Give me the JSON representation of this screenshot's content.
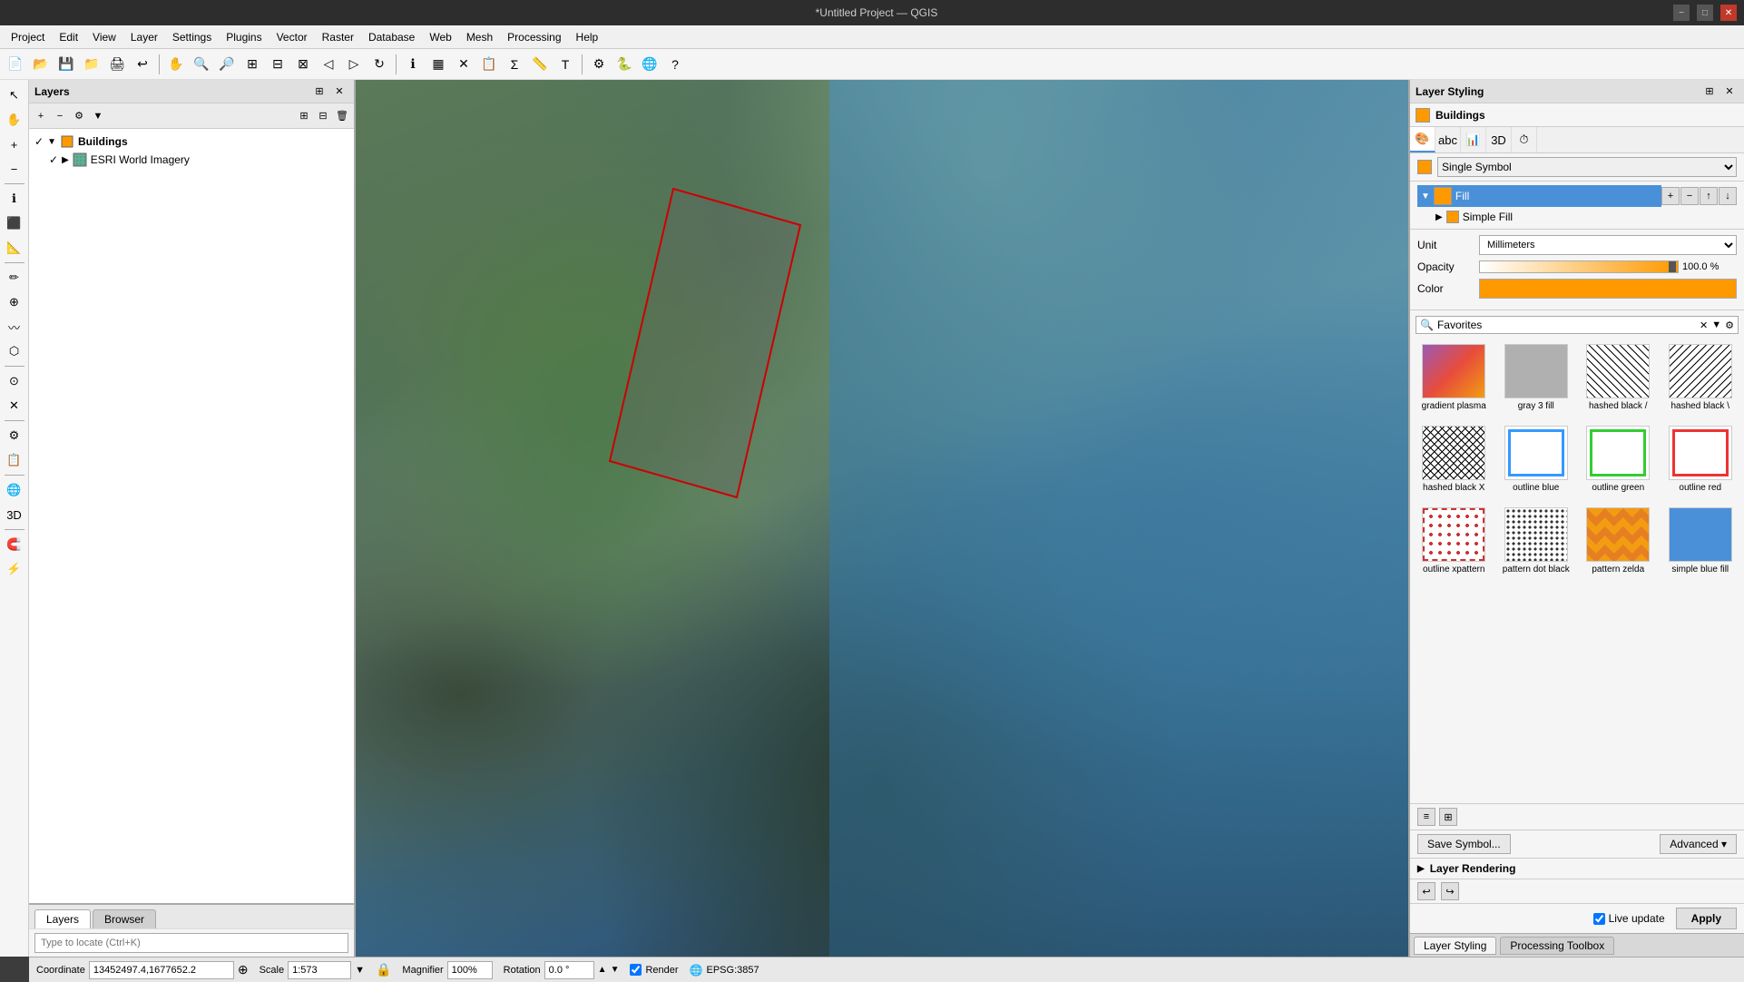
{
  "titlebar": {
    "title": "*Untitled Project — QGIS",
    "minimize": "−",
    "maximize": "□",
    "close": "✕"
  },
  "menubar": {
    "items": [
      "Project",
      "Edit",
      "View",
      "Layer",
      "Settings",
      "Plugins",
      "Vector",
      "Raster",
      "Database",
      "Web",
      "Mesh",
      "Processing",
      "Help"
    ]
  },
  "layers_panel": {
    "title": "Layers",
    "layers": [
      {
        "name": "Buildings",
        "type": "vector",
        "visible": true,
        "bold": true
      },
      {
        "name": "ESRI World Imagery",
        "type": "raster",
        "visible": true,
        "bold": false
      }
    ]
  },
  "layer_styling": {
    "title": "Layer Styling",
    "layer_name": "Buildings",
    "renderer_type": "Single Symbol",
    "symbol_tree": {
      "fill_label": "Fill",
      "simple_fill_label": "Simple Fill"
    },
    "properties": {
      "unit_label": "Unit",
      "unit_value": "Millimeters",
      "opacity_label": "Opacity",
      "opacity_value": "100.0 %",
      "color_label": "Color"
    },
    "favorites_search": "Favorites",
    "symbols": [
      {
        "id": "gradient-plasma",
        "name": "gradient plasma",
        "type": "gradient"
      },
      {
        "id": "gray-3-fill",
        "name": "gray 3 fill",
        "type": "gray"
      },
      {
        "id": "hashed-black-fwd",
        "name": "hashed black /",
        "type": "hashed-fwd"
      },
      {
        "id": "hashed-black-bwd",
        "name": "hashed black \\",
        "type": "hashed-bwd"
      },
      {
        "id": "hashed-black-x",
        "name": "hashed black X",
        "type": "hashed-cross"
      },
      {
        "id": "outline-blue",
        "name": "outline blue",
        "type": "outline-blue"
      },
      {
        "id": "outline-green",
        "name": "outline green",
        "type": "outline-green"
      },
      {
        "id": "outline-red",
        "name": "outline red",
        "type": "outline-red"
      },
      {
        "id": "outline-xpattern",
        "name": "outline xpattern",
        "type": "outline-xpattern"
      },
      {
        "id": "pattern-dot-black",
        "name": "pattern dot black",
        "type": "pattern-dot"
      },
      {
        "id": "pattern-zelda",
        "name": "pattern zelda",
        "type": "pattern-zelda"
      },
      {
        "id": "simple-blue-fill",
        "name": "simple blue fill",
        "type": "simple-blue"
      }
    ],
    "save_symbol_label": "Save Symbol...",
    "advanced_label": "Advanced ▾",
    "live_update_label": "Live update",
    "apply_label": "Apply"
  },
  "tabs": {
    "layer_styling_tab": "Layer Styling",
    "processing_toolbox_tab": "Processing Toolbox"
  },
  "bottom_tabs": {
    "layers": "Layers",
    "browser": "Browser"
  },
  "statusbar": {
    "coordinate_label": "Coordinate",
    "coordinate_value": "13452497.4,1677652.2",
    "scale_label": "Scale",
    "scale_value": "1:573",
    "magnifier_label": "Magnifier",
    "magnifier_value": "100%",
    "rotation_label": "Rotation",
    "rotation_value": "0.0 °",
    "render_label": "Render",
    "epsg_label": "EPSG:3857",
    "search_placeholder": "Type to locate (Ctrl+K)"
  }
}
